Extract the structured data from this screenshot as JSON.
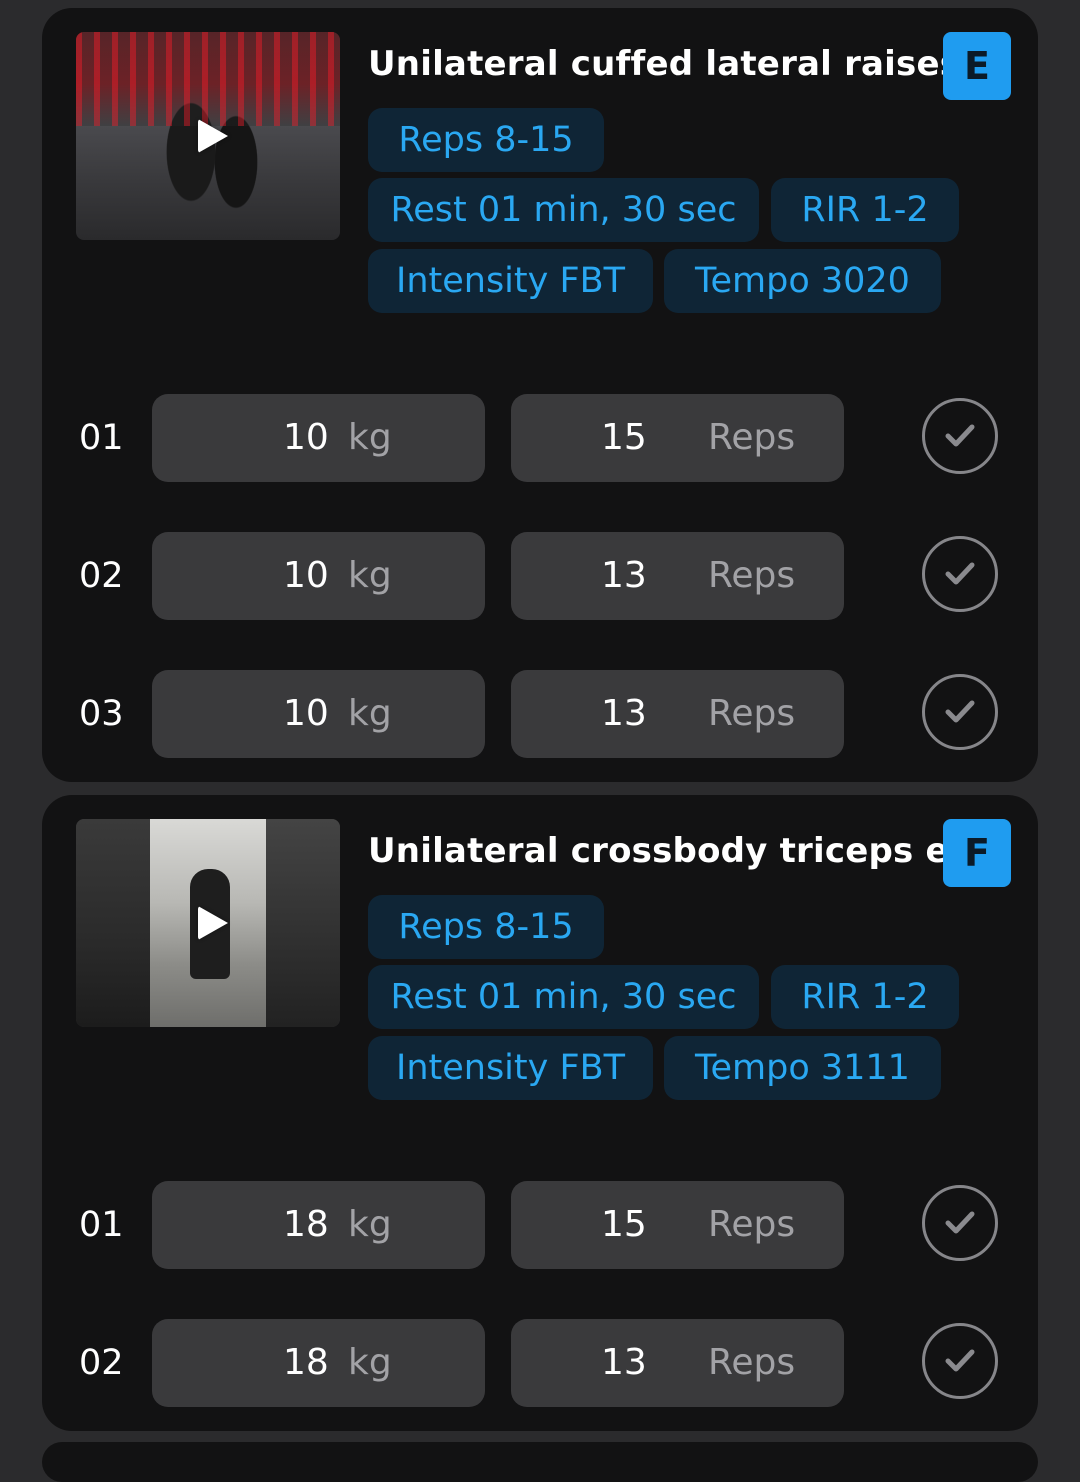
{
  "exercises": [
    {
      "title": "Unilateral cuffed lateral raises",
      "badge": "E",
      "video_icon": "play-icon",
      "chips": {
        "reps": "Reps 8-15",
        "rest": "Rest 01 min, 30 sec",
        "rir": "RIR 1-2",
        "intensity": "Intensity FBT",
        "tempo": "Tempo 3020"
      },
      "sets": [
        {
          "num": "01",
          "weight": "10",
          "weight_unit": "kg",
          "reps": "15",
          "reps_unit": "Reps"
        },
        {
          "num": "02",
          "weight": "10",
          "weight_unit": "kg",
          "reps": "13",
          "reps_unit": "Reps"
        },
        {
          "num": "03",
          "weight": "10",
          "weight_unit": "kg",
          "reps": "13",
          "reps_unit": "Reps"
        }
      ]
    },
    {
      "title": "Unilateral crossbody triceps ext",
      "badge": "F",
      "video_icon": "play-icon",
      "chips": {
        "reps": "Reps 8-15",
        "rest": "Rest 01 min, 30 sec",
        "rir": "RIR 1-2",
        "intensity": "Intensity FBT",
        "tempo": "Tempo 3111"
      },
      "sets": [
        {
          "num": "01",
          "weight": "18",
          "weight_unit": "kg",
          "reps": "15",
          "reps_unit": "Reps"
        },
        {
          "num": "02",
          "weight": "18",
          "weight_unit": "kg",
          "reps": "13",
          "reps_unit": "Reps"
        }
      ]
    }
  ],
  "colors": {
    "background": "#2b2b2d",
    "card": "#121213",
    "accent": "#1f9cf0",
    "chip_bg": "#0f2536",
    "chip_text": "#2aa8f2",
    "field_bg": "#3a3a3c",
    "muted_text": "#a2a2a6"
  },
  "icons": {
    "check": "check-icon",
    "play": "play-icon"
  }
}
